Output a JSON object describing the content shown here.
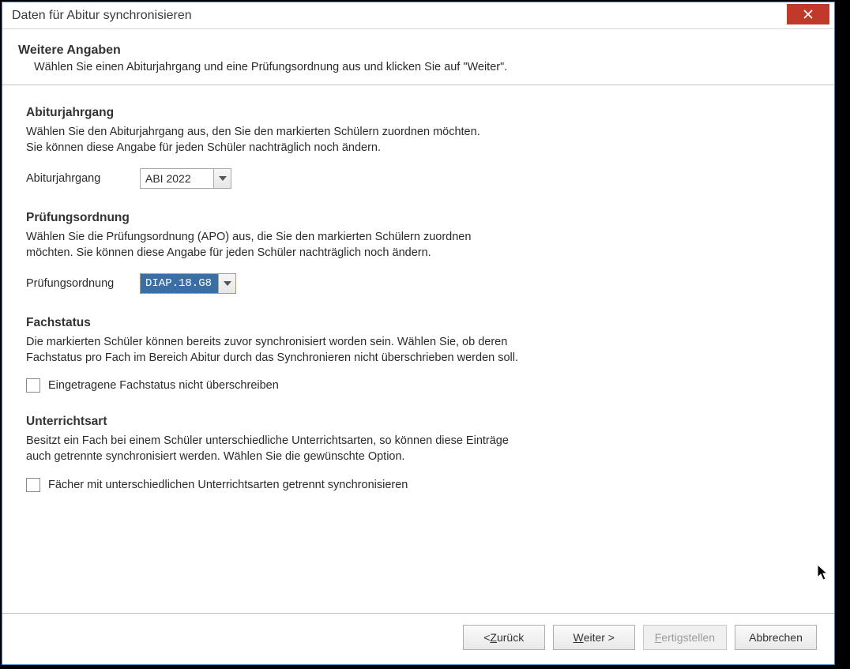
{
  "window": {
    "title": "Daten für Abitur synchronisieren"
  },
  "header": {
    "heading": "Weitere Angaben",
    "subtitle": "Wählen Sie einen Abiturjahrgang und eine Prüfungsordnung aus und klicken Sie auf \"Weiter\"."
  },
  "sections": {
    "jahrgang": {
      "heading": "Abiturjahrgang",
      "desc_line1": "Wählen Sie den Abiturjahrgang aus, den Sie den markierten Schülern zuordnen möchten.",
      "desc_line2": "Sie können diese Angabe für jeden Schüler nachträglich noch ändern.",
      "field_label": "Abiturjahrgang",
      "field_value": "ABI 2022"
    },
    "ordnung": {
      "heading": "Prüfungsordnung",
      "desc_line1": "Wählen Sie die Prüfungsordnung (APO) aus, die Sie den markierten Schülern zuordnen",
      "desc_line2": "möchten. Sie können diese Angabe für jeden Schüler nachträglich noch ändern.",
      "field_label": "Prüfungsordnung",
      "field_value": "DIAP.18.G8"
    },
    "fachstatus": {
      "heading": "Fachstatus",
      "desc_line1": "Die markierten Schüler können bereits zuvor synchronisiert worden sein. Wählen Sie, ob deren",
      "desc_line2": "Fachstatus pro Fach im Bereich Abitur durch das Synchronieren nicht überschrieben werden soll.",
      "check_label": "Eingetragene Fachstatus nicht überschreiben"
    },
    "unterrichtsart": {
      "heading": "Unterrichtsart",
      "desc_line1": "Besitzt ein Fach bei einem Schüler unterschiedliche Unterrichtsarten, so können diese Einträge",
      "desc_line2": "auch getrennte synchronisiert werden. Wählen Sie die gewünschte Option.",
      "check_label": "Fächer mit unterschiedlichen Unterrichtsarten getrennt synchronisieren"
    }
  },
  "buttons": {
    "back_prefix": "< ",
    "back_mnemonic": "Z",
    "back_suffix": "urück",
    "next_mnemonic": "W",
    "next_suffix": "eiter >",
    "finish_mnemonic": "F",
    "finish_suffix": "ertigstellen",
    "cancel": "Abbrechen"
  }
}
